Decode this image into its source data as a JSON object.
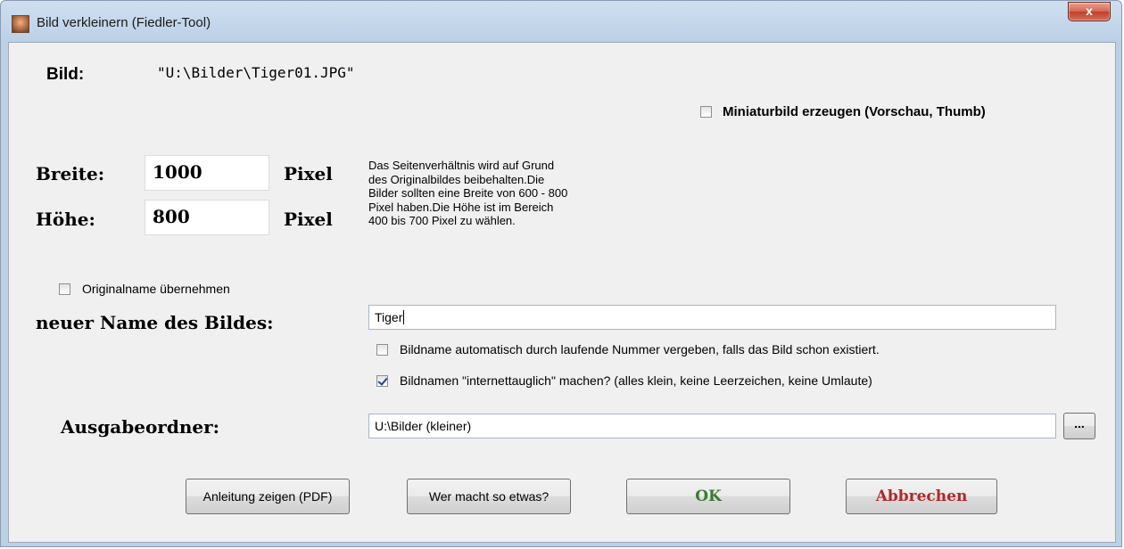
{
  "window": {
    "title": "Bild verkleinern (Fiedler-Tool)",
    "close_label": "x"
  },
  "image": {
    "label": "Bild:",
    "path": "\"U:\\Bilder\\Tiger01.JPG\""
  },
  "thumbnail": {
    "label": "Miniaturbild erzeugen (Vorschau, Thumb)",
    "checked": false
  },
  "dimensions": {
    "width_label": "Breite:",
    "width_value": "1000",
    "height_label": "Höhe:",
    "height_value": "800",
    "unit": "Pixel",
    "info_lines": [
      "Das Seitenverhältnis wird auf Grund",
      "des Originalbildes beibehalten.Die",
      "Bilder sollten eine Breite von 600 - 800",
      "Pixel haben.Die Höhe ist im Bereich",
      "400 bis 700 Pixel zu wählen."
    ]
  },
  "naming": {
    "keep_original_label": "Originalname übernehmen",
    "keep_original_checked": false,
    "new_name_label": "neuer Name des Bildes:",
    "new_name_value": "Tiger",
    "auto_number_label": "Bildname automatisch durch laufende Nummer vergeben, falls das Bild schon existiert.",
    "auto_number_checked": false,
    "web_safe_label": "Bildnamen \"internettauglich\" machen? (alles klein, keine Leerzeichen, keine Umlaute)",
    "web_safe_checked": true
  },
  "output": {
    "label": "Ausgabeordner:",
    "folder": "U:\\Bilder (kleiner)",
    "browse_label": "..."
  },
  "buttons": {
    "manual": "Anleitung zeigen (PDF)",
    "about": "Wer macht so etwas?",
    "ok": "OK",
    "cancel": "Abbrechen"
  },
  "colors": {
    "ok_text": "#3c7a32",
    "cancel_text": "#b0282a"
  }
}
